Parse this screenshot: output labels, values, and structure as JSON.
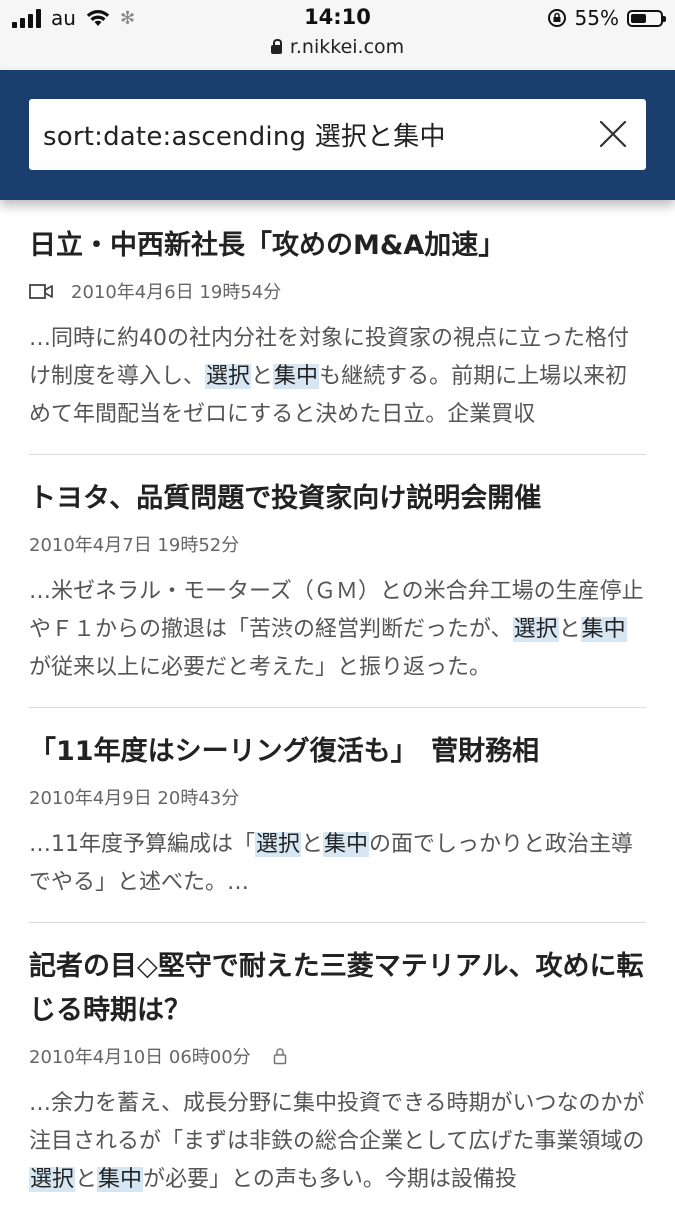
{
  "status_bar": {
    "carrier": "au",
    "time": "14:10",
    "battery": "55%",
    "battery_level": 0.55,
    "url": "r.nikkei.com"
  },
  "search": {
    "query": "sort:date:ascending  選択と集中"
  },
  "articles": [
    {
      "title": "日立・中西新社長「攻めのM&A加速」",
      "date": "2010年4月6日 19時54分",
      "has_video": true,
      "locked": false,
      "snippet": [
        {
          "t": "…同時に約40の社内分社を対象に投資家の視点に立った格付け制度を導入し、"
        },
        {
          "t": "選択",
          "hl": true
        },
        {
          "t": "と"
        },
        {
          "t": "集中",
          "hl": true
        },
        {
          "t": "も継続する。前期に上場以来初めて年間配当をゼロにすると決めた日立。企業買収"
        }
      ]
    },
    {
      "title": "トヨタ、品質問題で投資家向け説明会開催",
      "date": "2010年4月7日 19時52分",
      "has_video": false,
      "locked": false,
      "snippet": [
        {
          "t": "…米ゼネラル・モーターズ（ＧＭ）との米合弁工場の生産停止やＦ１からの撤退は「苦渋の経営判断だったが、"
        },
        {
          "t": "選択",
          "hl": true
        },
        {
          "t": "と"
        },
        {
          "t": "集中",
          "hl": true
        },
        {
          "t": "が従来以上に必要だと考えた」と振り返った。"
        }
      ]
    },
    {
      "title": "「11年度はシーリング復活も」　菅財務相",
      "date": "2010年4月9日 20時43分",
      "has_video": false,
      "locked": false,
      "snippet": [
        {
          "t": "…11年度予算編成は「"
        },
        {
          "t": "選択",
          "hl": true
        },
        {
          "t": "と"
        },
        {
          "t": "集中",
          "hl": true
        },
        {
          "t": "の面でしっかりと政治主導でやる」と述べた。…"
        }
      ]
    },
    {
      "title": "記者の目◇堅守で耐えた三菱マテリアル、攻めに転じる時期は？",
      "date": "2010年4月10日 06時00分",
      "has_video": false,
      "locked": true,
      "snippet": [
        {
          "t": "…余力を蓄え、成長分野に集中投資できる時期がいつなのかが注目されるが「まずは非鉄の総合企業として広げた事業領域の"
        },
        {
          "t": "選択",
          "hl": true
        },
        {
          "t": "と"
        },
        {
          "t": "集中",
          "hl": true
        },
        {
          "t": "が必要」との声も多い。今期は設備投"
        }
      ]
    }
  ]
}
